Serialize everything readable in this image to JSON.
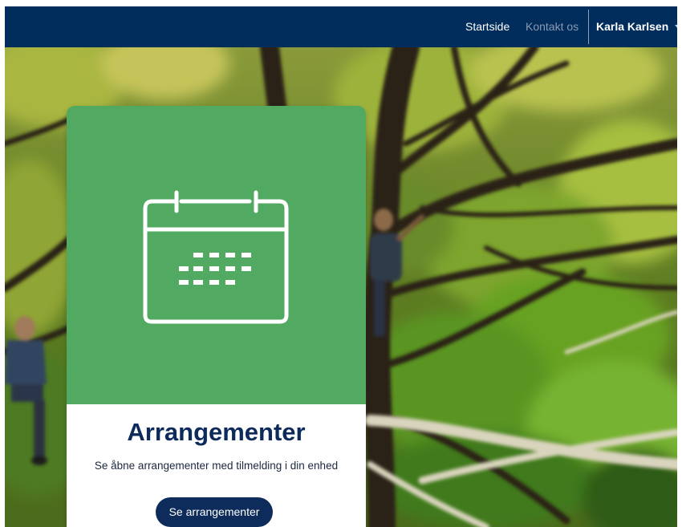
{
  "navbar": {
    "home_label": "Startside",
    "contact_label": "Kontakt os",
    "user_name": "Karla Karlsen",
    "background_color": "#002d5b"
  },
  "hero": {
    "image_subject": "forest-with-people-in-trees"
  },
  "card": {
    "icon": "calendar-icon",
    "title": "Arrangementer",
    "description": "Se åbne arrangementer med tilmelding i din enhed",
    "button_label": "Se arrangementer",
    "accent_color": "#52aa62",
    "button_color": "#0e2c5b"
  }
}
